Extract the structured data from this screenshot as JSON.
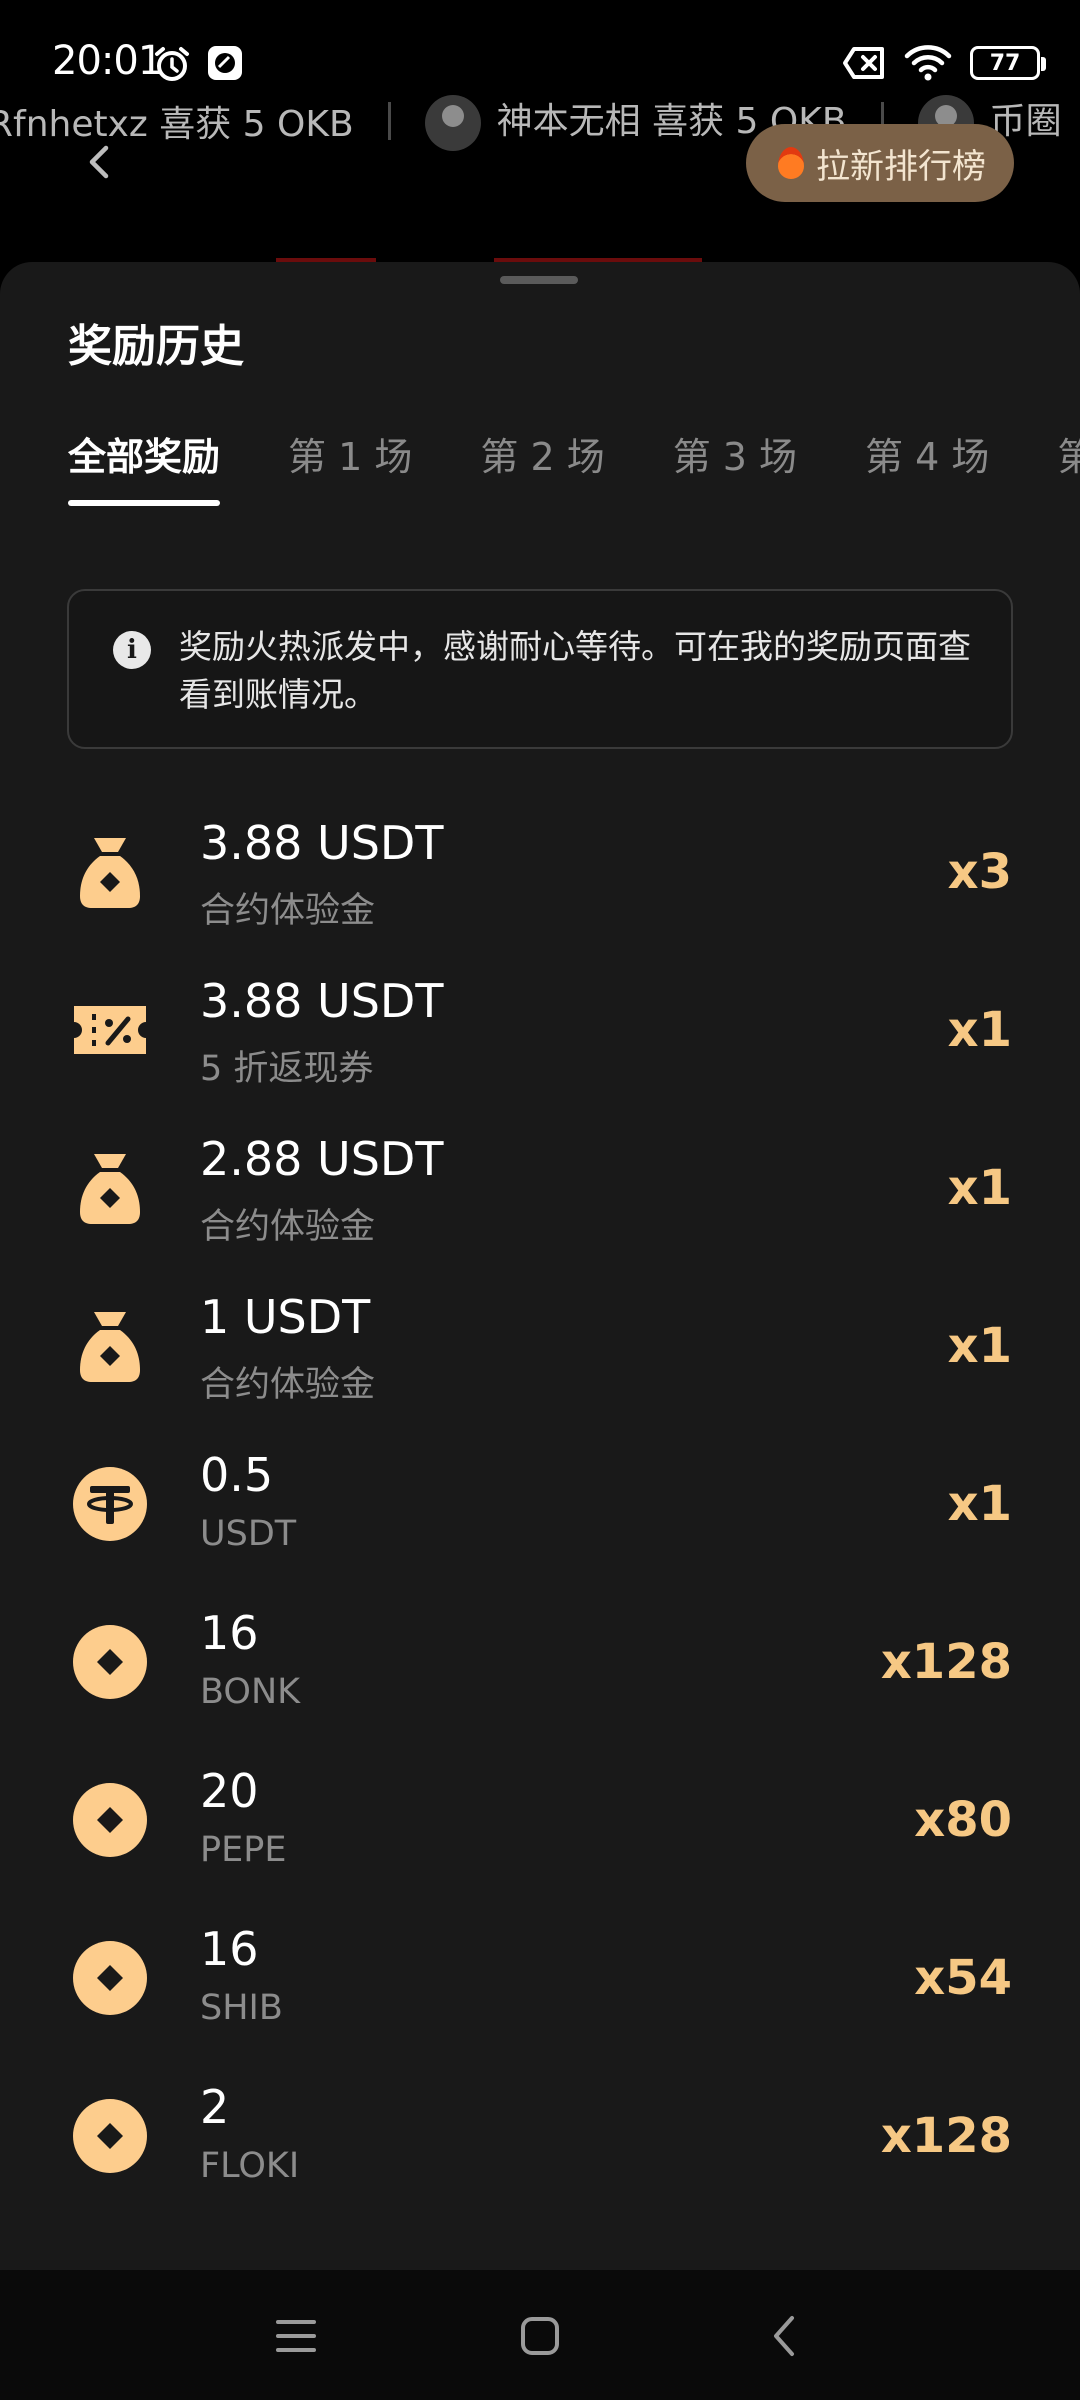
{
  "status_bar": {
    "time": "20:01",
    "battery": "77",
    "left_icons": [
      "alarm-icon",
      "app-notification-icon"
    ],
    "right_icons": [
      "no-sim-icon",
      "wifi-icon",
      "battery-icon"
    ]
  },
  "ticker": {
    "items": [
      {
        "text": "Rfnhetxz 喜获 5 OKB",
        "has_avatar": false
      },
      {
        "text": "神本无相 喜获 5 OKB",
        "has_avatar": true
      },
      {
        "text": "币圈",
        "has_avatar": true
      }
    ]
  },
  "header": {
    "invite_rank_label": "拉新排行榜"
  },
  "sheet": {
    "title": "奖励历史",
    "tabs": [
      {
        "label": "全部奖励",
        "active": true
      },
      {
        "label": "第 1 场",
        "active": false
      },
      {
        "label": "第 2 场",
        "active": false
      },
      {
        "label": "第 3 场",
        "active": false
      },
      {
        "label": "第 4 场",
        "active": false
      },
      {
        "label": "第",
        "active": false
      }
    ],
    "notice": "奖励火热派发中，感谢耐心等待。可在我的奖励页面查看到账情况。",
    "rewards": [
      {
        "amount": "3.88 USDT",
        "subtitle": "合约体验金",
        "multiplier": "x3",
        "icon": "money-bag-icon"
      },
      {
        "amount": "3.88 USDT",
        "subtitle": "5 折返现券",
        "multiplier": "x1",
        "icon": "coupon-icon"
      },
      {
        "amount": "2.88 USDT",
        "subtitle": "合约体验金",
        "multiplier": "x1",
        "icon": "money-bag-icon"
      },
      {
        "amount": "1 USDT",
        "subtitle": "合约体验金",
        "multiplier": "x1",
        "icon": "money-bag-icon"
      },
      {
        "amount": "0.5",
        "subtitle": "USDT",
        "multiplier": "x1",
        "icon": "tether-coin-icon"
      },
      {
        "amount": "16",
        "subtitle": "BONK",
        "multiplier": "x128",
        "icon": "token-coin-icon"
      },
      {
        "amount": "20",
        "subtitle": "PEPE",
        "multiplier": "x80",
        "icon": "token-coin-icon"
      },
      {
        "amount": "16",
        "subtitle": "SHIB",
        "multiplier": "x54",
        "icon": "token-coin-icon"
      },
      {
        "amount": "2",
        "subtitle": "FLOKI",
        "multiplier": "x128",
        "icon": "token-coin-icon"
      }
    ]
  },
  "colors": {
    "accent_gold": "#f6c884",
    "icon_fill": "#fdcd8d",
    "sheet_bg": "#191919",
    "button_bg": "#7b6147"
  },
  "nav": {
    "buttons": [
      "menu-icon",
      "home-icon",
      "back-icon"
    ]
  }
}
